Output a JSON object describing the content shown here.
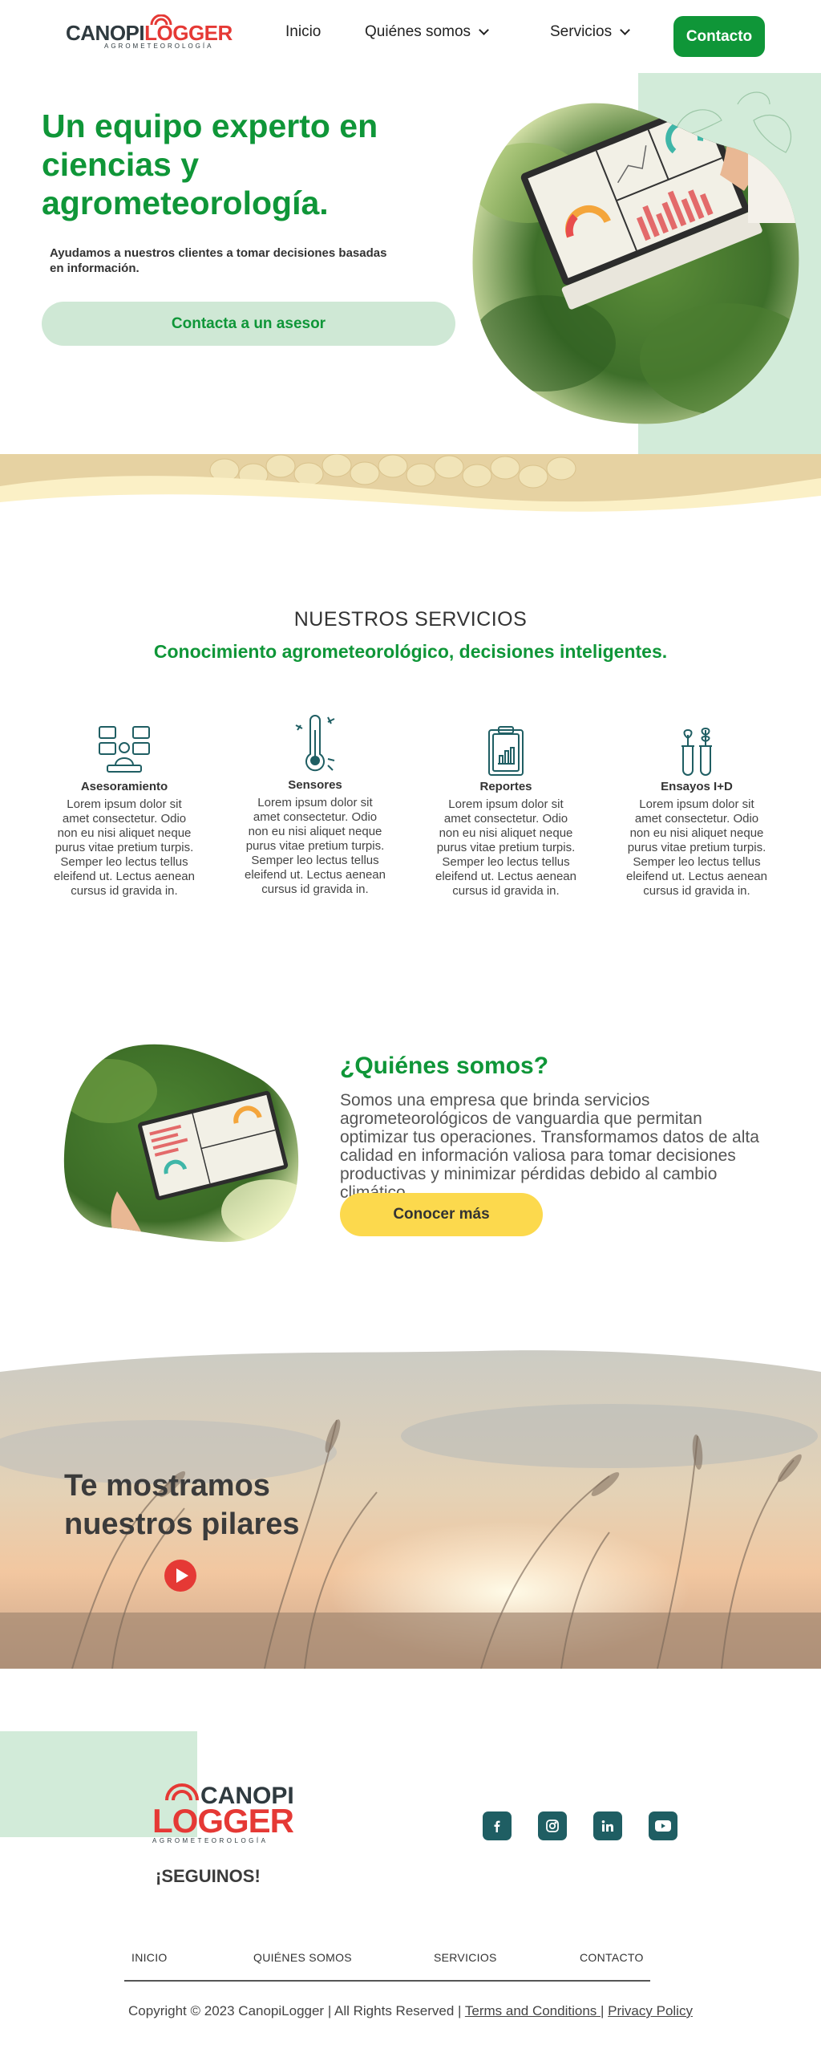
{
  "brand": {
    "name_part1": "CANOPI",
    "name_part2": "LOGGER",
    "tagline": "AGROMETEOROLOGÍA"
  },
  "nav": {
    "items": [
      {
        "label": "Inicio",
        "dropdown": false
      },
      {
        "label": "Quiénes somos",
        "dropdown": true
      },
      {
        "label": "Servicios",
        "dropdown": true
      }
    ],
    "cta": "Contacto"
  },
  "hero": {
    "title": "Un equipo experto en ciencias y agrometeorología.",
    "subtitle": "Ayudamos a nuestros clientes a tomar decisiones basadas en información.",
    "button": "Contacta a un asesor"
  },
  "services": {
    "kicker": "NUESTROS SERVICIOS",
    "title": "Conocimiento agrometeorológico, decisiones inteligentes.",
    "items": [
      {
        "icon": "consulting-icon",
        "title": "Asesoramiento",
        "text": "Lorem ipsum dolor sit amet consectetur. Odio non eu nisi aliquet neque purus vitae pretium turpis. Semper leo lectus tellus eleifend ut. Lectus aenean cursus id gravida in."
      },
      {
        "icon": "thermometer-icon",
        "title": "Sensores",
        "text": "Lorem ipsum dolor sit amet consectetur. Odio non eu nisi aliquet neque purus vitae pretium turpis. Semper leo lectus tellus eleifend ut. Lectus aenean cursus id gravida in."
      },
      {
        "icon": "clipboard-chart-icon",
        "title": "Reportes",
        "text": "Lorem ipsum dolor sit amet consectetur. Odio non eu nisi aliquet neque purus vitae pretium turpis. Semper leo lectus tellus eleifend ut. Lectus aenean cursus id gravida in."
      },
      {
        "icon": "test-tubes-plant-icon",
        "title": "Ensayos I+D",
        "text": "Lorem ipsum dolor sit amet consectetur. Odio non eu nisi aliquet neque purus vitae pretium turpis. Semper leo lectus tellus eleifend ut. Lectus aenean cursus id gravida in."
      }
    ]
  },
  "about": {
    "title": "¿Quiénes somos?",
    "text": "Somos una empresa que brinda servicios agrometeorológicos de vanguardia que permitan optimizar tus operaciones. Transformamos datos de alta calidad en información valiosa para tomar decisiones productivas y minimizar pérdidas debido al cambio climático",
    "button": "Conocer más"
  },
  "video": {
    "title": "Te mostramos nuestros pilares"
  },
  "footer": {
    "follow": "¡SEGUINOS!",
    "social": [
      "facebook-icon",
      "instagram-icon",
      "linkedin-icon",
      "youtube-icon"
    ],
    "nav": [
      "INICIO",
      "QUIÉNES SOMOS",
      "SERVICIOS",
      "CONTACTO"
    ],
    "copyright": "Copyright © 2023 CanopiLogger | All Rights Reserved |",
    "terms": "Terms and Conditions ",
    "separator": "|",
    "privacy": "Privacy Policy"
  },
  "colors": {
    "brand_green": "#0f9638",
    "light_green": "#d2ebd9",
    "brand_red": "#e53935",
    "yellow": "#fcd94d",
    "teal": "#1f5e63"
  }
}
